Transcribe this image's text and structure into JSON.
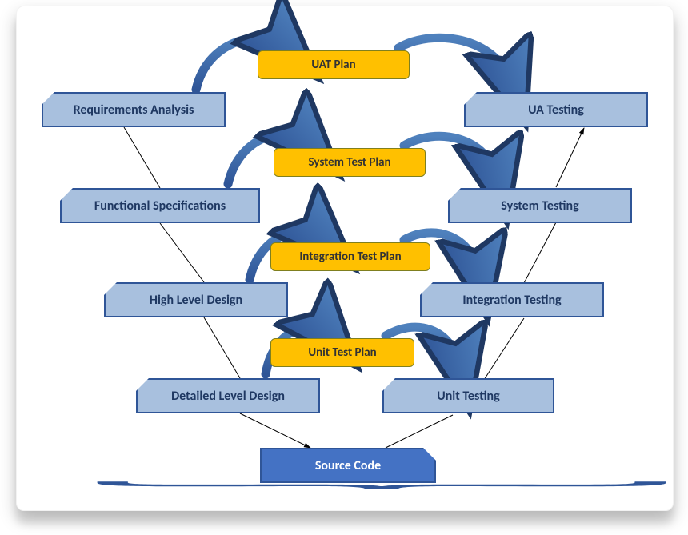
{
  "diagram": {
    "leftStages": [
      {
        "label": "Requirements Analysis"
      },
      {
        "label": "Functional Specifications"
      },
      {
        "label": "High Level Design"
      },
      {
        "label": "Detailed Level Design"
      }
    ],
    "rightStages": [
      {
        "label": "UA Testing"
      },
      {
        "label": "System Testing"
      },
      {
        "label": "Integration Testing"
      },
      {
        "label": "Unit Testing"
      }
    ],
    "plans": [
      {
        "label": "UAT Plan"
      },
      {
        "label": "System Test Plan"
      },
      {
        "label": "Integration Test Plan"
      },
      {
        "label": "Unit Test Plan"
      }
    ],
    "source": {
      "label": "Source  Code"
    }
  },
  "colors": {
    "stageFill": "#a8c0de",
    "stageBorder": "#2f5597",
    "planFill": "#ffc000",
    "sourceFill": "#4472c4",
    "arrow": "#2f5597"
  }
}
